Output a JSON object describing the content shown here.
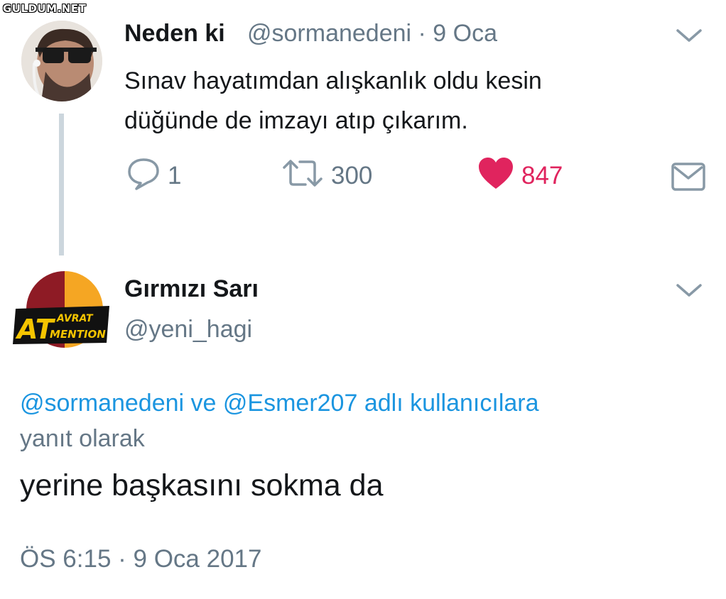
{
  "watermark": "GULDUM.NET",
  "tweet1": {
    "name": "Neden ki",
    "handle": "@sormanedeni",
    "sep": " · ",
    "date": "9 Oca",
    "text_line1": "Sınav hayatımdan alışkanlık oldu kesin",
    "text_line2": "düğünde de imzayı atıp çıkarım.",
    "replies": "1",
    "retweets": "300",
    "likes": "847"
  },
  "tweet2": {
    "name": "Gırmızı Sarı",
    "handle": "@yeni_hagi",
    "avatar_text_big": "AT",
    "avatar_text_top": "AVRAT",
    "avatar_text_bottom": "MENTION",
    "reply_mention1": "@sormanedeni",
    "reply_ve": " ve ",
    "reply_mention2": "@Esmer207",
    "reply_suffix": " adlı kullanıcılara",
    "reply_line2": "yanıt olarak",
    "text": "yerine başkasını sokma da",
    "timestamp": "ÖS 6:15 · 9 Oca 2017"
  },
  "colors": {
    "text": "#14171a",
    "secondary": "#657786",
    "link": "#1b95e0",
    "like": "#e0245e",
    "thread_line": "#ccd6dd",
    "avatar_red": "#8e1b25",
    "avatar_yellow": "#f5a623"
  },
  "icons": [
    "chevron-down-icon",
    "reply-icon",
    "retweet-icon",
    "heart-icon",
    "message-icon"
  ]
}
